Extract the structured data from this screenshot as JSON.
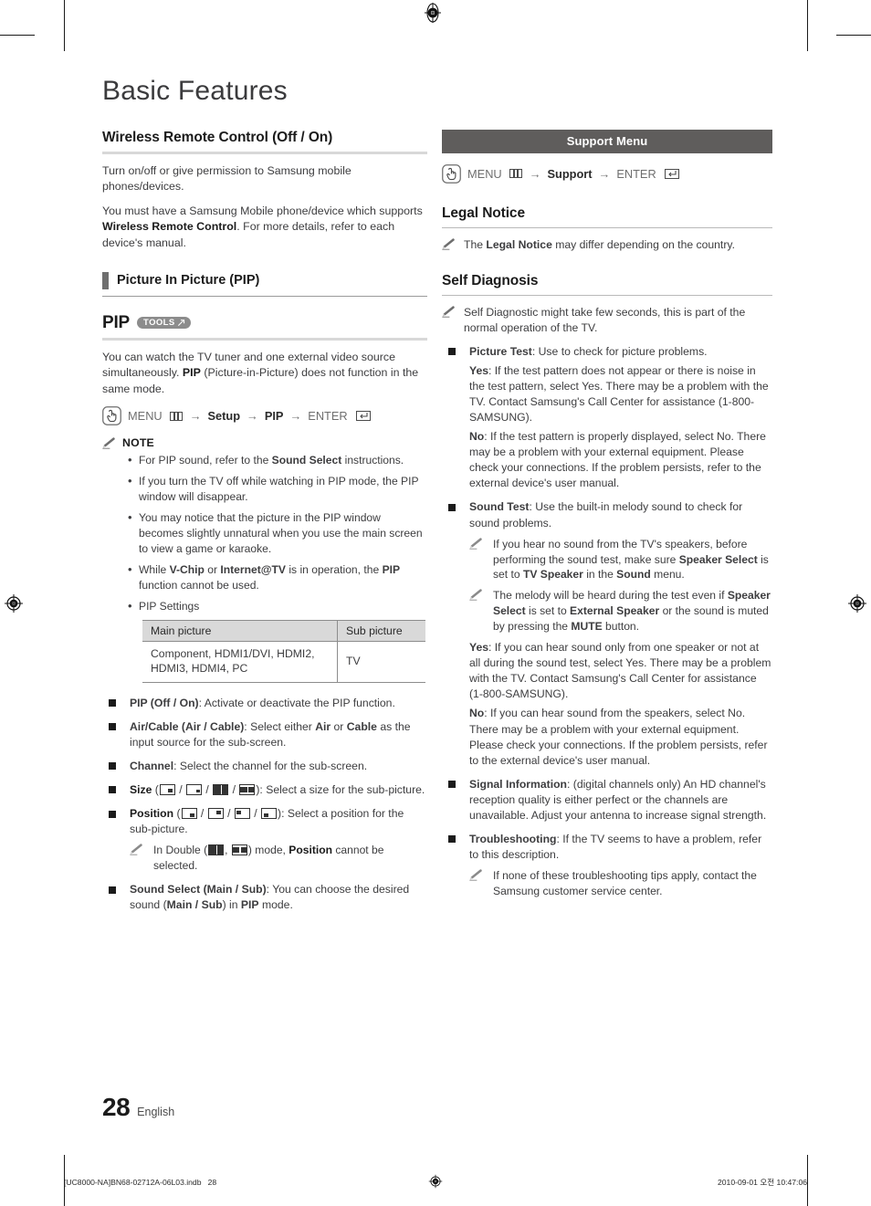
{
  "page": {
    "title": "Basic Features",
    "number": "28",
    "language": "English"
  },
  "left": {
    "wireless": {
      "heading": "Wireless Remote Control (Off / On)",
      "paragraphs": [
        "Turn on/off or give permission to Samsung mobile phones/devices.",
        "You must have a Samsung Mobile phone/device which supports <b>Wireless Remote Control</b>. For more details, refer to each device's manual."
      ]
    },
    "pip_subhead": "Picture In Picture (PIP)",
    "pip": {
      "label": "PIP",
      "tools_badge": "TOOLS",
      "intro": "You can watch the TV tuner and one external video source simultaneously. <b>PIP</b> (Picture-in-Picture) does not function in the same mode.",
      "menupath": {
        "menu": "MENU",
        "arrow": "→",
        "step1": "Setup",
        "step2": "PIP",
        "enter": "ENTER"
      },
      "note_label": "NOTE",
      "notes": [
        "For PIP sound, refer to the <b>Sound Select</b> instructions.",
        "If you turn the TV off while watching in PIP mode, the PIP window will disappear.",
        "You may notice that the picture in the PIP window becomes slightly unnatural when you use the main screen to view a game or karaoke.",
        "While <b>V-Chip</b> or <b>Internet@TV</b> is in operation, the <b>PIP</b> function cannot be used.",
        "PIP Settings"
      ],
      "table": {
        "headers": [
          "Main picture",
          "Sub picture"
        ],
        "rows": [
          [
            "Component, HDMI1/DVI, HDMI2, HDMI3, HDMI4, PC",
            "TV"
          ]
        ]
      },
      "options": [
        "<b>PIP (Off / On)</b>: Activate or deactivate the PIP function.",
        "<b>Air/Cable (Air / Cable)</b>: Select either <b>Air</b> or <b>Cable</b> as the input source for the sub-screen.",
        "<b>Channel</b>: Select the channel for the sub-screen.",
        "<b>Sound Select (Main / Sub)</b>: You can choose the desired sound (<b>Main / Sub</b>) in <b>PIP</b> mode."
      ],
      "size_label": "Size",
      "size_tail": ": Select a size for the sub-picture.",
      "position_label": "Position",
      "position_tail": ": Select a position for the sub-picture.",
      "double_note": "In Double (<icons>) mode, <b>Position</b> cannot be selected.",
      "double_note_pre": "In Double (",
      "double_note_mid": ") mode, ",
      "double_note_bold": "Position",
      "double_note_post": " cannot be selected."
    }
  },
  "right": {
    "support_bar": "Support Menu",
    "menupath": {
      "menu": "MENU",
      "arrow": "→",
      "step1": "Support",
      "enter": "ENTER"
    },
    "legal": {
      "heading": "Legal Notice",
      "note": "The <b>Legal Notice</b> may differ depending on the country."
    },
    "selfdiag": {
      "heading": "Self Diagnosis",
      "top_note": "Self Diagnostic might take few seconds, this is part of the normal operation of the TV.",
      "items": [
        {
          "main": "<b>Picture Test</b>: Use to check for picture problems.",
          "paras": [
            "<b>Yes</b>: If the test pattern does not appear or there is noise in the test pattern, select Yes. There may be a problem with the TV. Contact Samsung's Call Center for assistance (1-800-SAMSUNG).",
            "<b>No</b>: If the test pattern is properly displayed, select No. There may be a problem with your external equipment. Please check your connections. If the problem persists, refer to the external device's user manual."
          ],
          "notes": []
        },
        {
          "main": "<b>Sound Test</b>: Use the built-in melody sound to check for sound problems.",
          "notes": [
            "If you hear no sound from the TV's speakers, before performing the sound test, make sure <b>Speaker Select</b> is set to <b>TV Speaker</b> in the <b>Sound</b> menu.",
            "The melody will be heard during the test even if <b>Speaker Select</b> is set to <b>External Speaker</b> or the sound is muted by pressing the <b>MUTE</b> button."
          ],
          "paras": [
            "<b>Yes</b>: If you can hear sound only from one speaker or not at all during the sound test, select Yes. There may be a problem with the TV. Contact Samsung's Call Center for assistance (1-800-SAMSUNG).",
            "<b>No</b>: If you can hear sound from the speakers, select No. There may be a problem with your external equipment. Please check your connections. If the problem persists, refer to the external device's user manual."
          ]
        },
        {
          "main": "<b>Signal Information</b>: (digital channels only) An HD channel's reception quality is either perfect or the channels are unavailable. Adjust your antenna to increase signal strength.",
          "paras": [],
          "notes": []
        },
        {
          "main": "<b>Troubleshooting</b>: If the TV seems to have a problem, refer to this description.",
          "paras": [],
          "notes": [
            "If none of these troubleshooting tips apply, contact the Samsung customer service center."
          ]
        }
      ]
    }
  },
  "colophon": {
    "file": "[UC8000-NA]BN68-02712A-06L03.indb   28",
    "timestamp": "2010-09-01   오전 10:47:06"
  },
  "colors": {
    "support_bar": "#5f5d5c",
    "tools_badge": "#8c8c8c",
    "rule": "#d8d8d8",
    "table_header": "#d9d9d9",
    "text": "#3d3d3f"
  }
}
